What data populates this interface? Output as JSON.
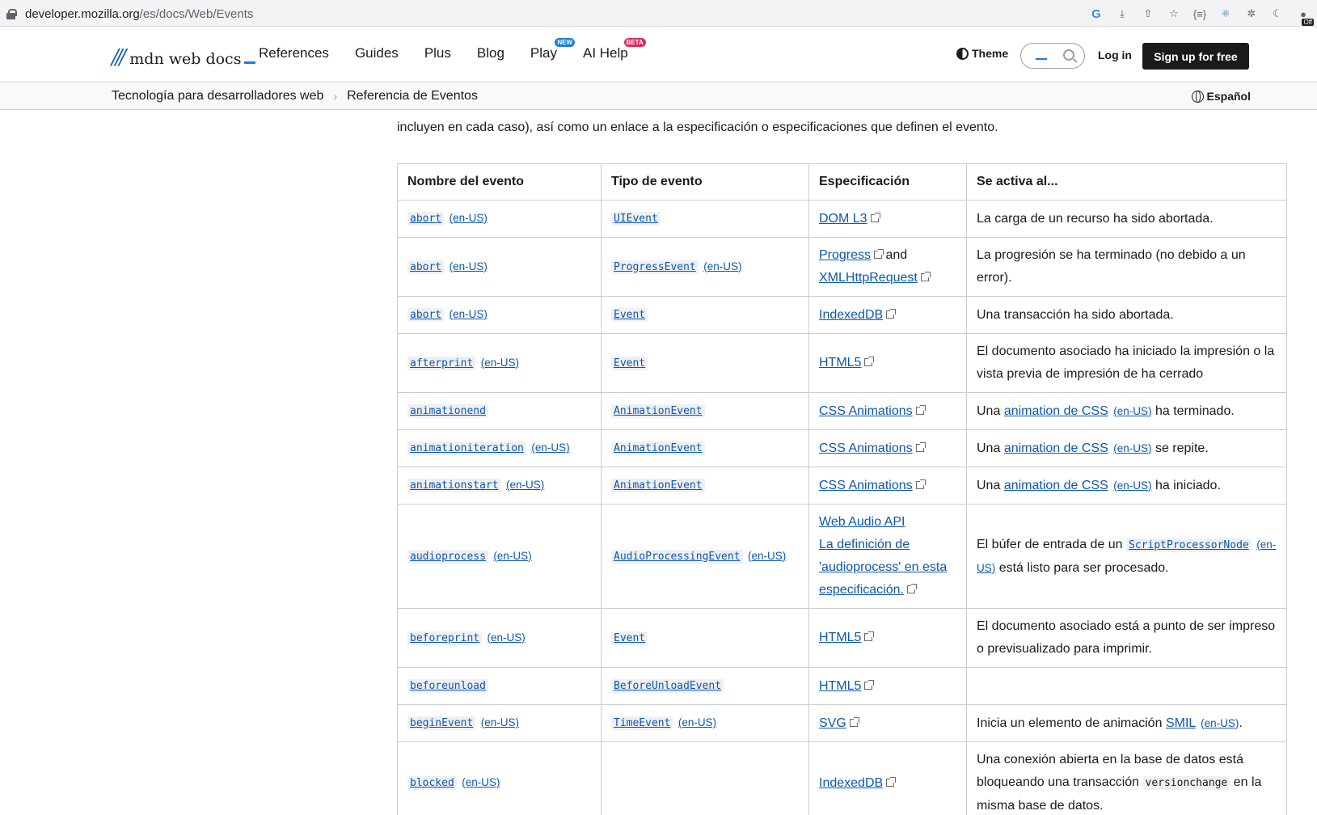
{
  "browser": {
    "url_host": "developer.mozilla.org",
    "url_path": "/es/docs/Web/Events",
    "extension_badge": "Off"
  },
  "header": {
    "logo_text": "mdn web docs",
    "nav": [
      {
        "label": "References",
        "tag": ""
      },
      {
        "label": "Guides",
        "tag": ""
      },
      {
        "label": "Plus",
        "tag": ""
      },
      {
        "label": "Blog",
        "tag": ""
      },
      {
        "label": "Play",
        "tag": "NEW"
      },
      {
        "label": "AI Help",
        "tag": "BETA"
      }
    ],
    "theme_label": "Theme",
    "login_label": "Log in",
    "signup_label": "Sign up for free"
  },
  "breadcrumbs": {
    "items": [
      "Tecnología para desarrolladores web",
      "Referencia de Eventos"
    ],
    "language": "Español"
  },
  "intro": "incluyen en cada caso), así como un enlace a la especificación o especificaciones que definen el evento.",
  "table": {
    "headers": [
      "Nombre del evento",
      "Tipo de evento",
      "Especificación",
      "Se activa al..."
    ],
    "en_label": "(en-US)",
    "rows": [
      {
        "name": "abort",
        "type": "UIEvent",
        "spec": "DOM L3",
        "desc": "La carga de un recurso ha sido abortada."
      },
      {
        "name": "abort",
        "type": "ProgressEvent",
        "spec": "Progress",
        "spec_mid": "and",
        "spec2": "XMLHttpRequest",
        "desc": "La progresión se ha terminado (no debido a un error)."
      },
      {
        "name": "abort",
        "type": "Event",
        "spec": "IndexedDB",
        "desc": "Una transacción ha sido abortada."
      },
      {
        "name": "afterprint",
        "type": "Event",
        "spec": "HTML5",
        "desc": "El documento asociado ha iniciado la impresión o la vista previa de impresión de ha cerrado"
      },
      {
        "name": "animationend",
        "type": "AnimationEvent",
        "spec": "CSS Animations",
        "desc_pre": "Una",
        "desc_link": "animation de CSS",
        "desc_post": "ha terminado."
      },
      {
        "name": "animationiteration",
        "type": "AnimationEvent",
        "spec": "CSS Animations",
        "desc_pre": "Una",
        "desc_link": "animation de CSS",
        "desc_post": "se repite."
      },
      {
        "name": "animationstart",
        "type": "AnimationEvent",
        "spec": "CSS Animations",
        "desc_pre": "Una",
        "desc_link": "animation de CSS",
        "desc_post": "ha iniciado."
      },
      {
        "name": "audioprocess",
        "type": "AudioProcessingEvent",
        "spec": "Web Audio API",
        "spec2": "La definición de 'audioprocess' en esta especificación.",
        "desc_pre": "El búfer de entrada de un",
        "desc_code": "ScriptProcessorNode",
        "desc_post": "está listo para ser procesado."
      },
      {
        "name": "beforeprint",
        "type": "Event",
        "spec": "HTML5",
        "desc": "El documento asociado está a punto de ser impreso o previsualizado para imprimir."
      },
      {
        "name": "beforeunload",
        "type": "BeforeUnloadEvent",
        "spec": "HTML5",
        "desc": ""
      },
      {
        "name": "beginEvent",
        "type": "TimeEvent",
        "spec": "SVG",
        "desc_pre": "Inicia un elemento de animación",
        "desc_link": "SMIL",
        "desc_post": "."
      },
      {
        "name": "blocked",
        "type": "",
        "spec": "IndexedDB",
        "desc_pre": "Una conexión abierta en la base de datos está bloqueando una transacción",
        "desc_plain_code": "versionchange",
        "desc_post": "en la misma base de datos."
      }
    ]
  }
}
